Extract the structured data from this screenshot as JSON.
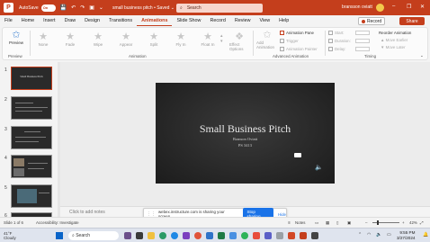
{
  "titlebar": {
    "autosave_label": "AutoSave",
    "autosave_state": "On",
    "document_title": "small business pitch • Saved ⌄",
    "search_placeholder": "Search",
    "user_name": "bransson oviatt",
    "minimize": "–",
    "restore": "❐",
    "close": "✕",
    "brand_color": "#c43e1c"
  },
  "menu": {
    "tabs": [
      "File",
      "Home",
      "Insert",
      "Draw",
      "Design",
      "Transitions",
      "Animations",
      "Slide Show",
      "Record",
      "Review",
      "View",
      "Help"
    ],
    "active_tab": "Animations",
    "record_label": "Record",
    "share_label": "Share"
  },
  "ribbon": {
    "preview_label": "Preview",
    "effects": [
      "None",
      "Appear",
      "Fade",
      "Fly In",
      "Float In",
      "Split",
      "Wipe",
      "Shape"
    ],
    "visible_effects": [
      "None",
      "Fade",
      "Wipe",
      "Appear",
      "Split",
      "Fly In",
      "Float In"
    ],
    "effect_options_label": "Effect Options",
    "add_animation_label": "Add Animation",
    "animation_pane_label": "Animation Pane",
    "trigger_label": "Trigger",
    "animation_painter_label": "Animation Painter",
    "start_label": "Start:",
    "duration_label": "Duration:",
    "delay_label": "Delay:",
    "reorder_label": "Reorder Animation",
    "move_earlier_label": "Move Earlier",
    "move_later_label": "Move Later",
    "groups": {
      "preview": "Preview",
      "animation": "Animation",
      "advanced": "Advanced Animation",
      "timing": "Timing"
    }
  },
  "slides": {
    "count": 6,
    "selected": 1,
    "thumbnails": [
      {
        "number": "1",
        "title": "Small Business Pitch"
      },
      {
        "number": "2",
        "title": ""
      },
      {
        "number": "3",
        "title": ""
      },
      {
        "number": "4",
        "title": ""
      },
      {
        "number": "5",
        "title": ""
      },
      {
        "number": "6",
        "title": ""
      }
    ]
  },
  "current_slide": {
    "title": "Small Business Pitch",
    "author": "Branson Oviatt",
    "course": "PS 3413"
  },
  "notes": {
    "placeholder": "Click to add notes"
  },
  "screen_share": {
    "message": "webex.instructure.com is sharing your screen.",
    "stop_label": "Stop sharing",
    "hide_label": "Hide"
  },
  "statusbar": {
    "slide_position": "Slide 1 of 6",
    "accessibility": "Accessibility: Investigate",
    "notes_label": "Notes",
    "zoom_level": "42%",
    "zoom_fraction": 0.42
  },
  "taskbar": {
    "temperature": "41°F",
    "weather": "Cloudy",
    "search_label": "Search",
    "time": "9:55 PM",
    "date": "3/27/2024"
  }
}
